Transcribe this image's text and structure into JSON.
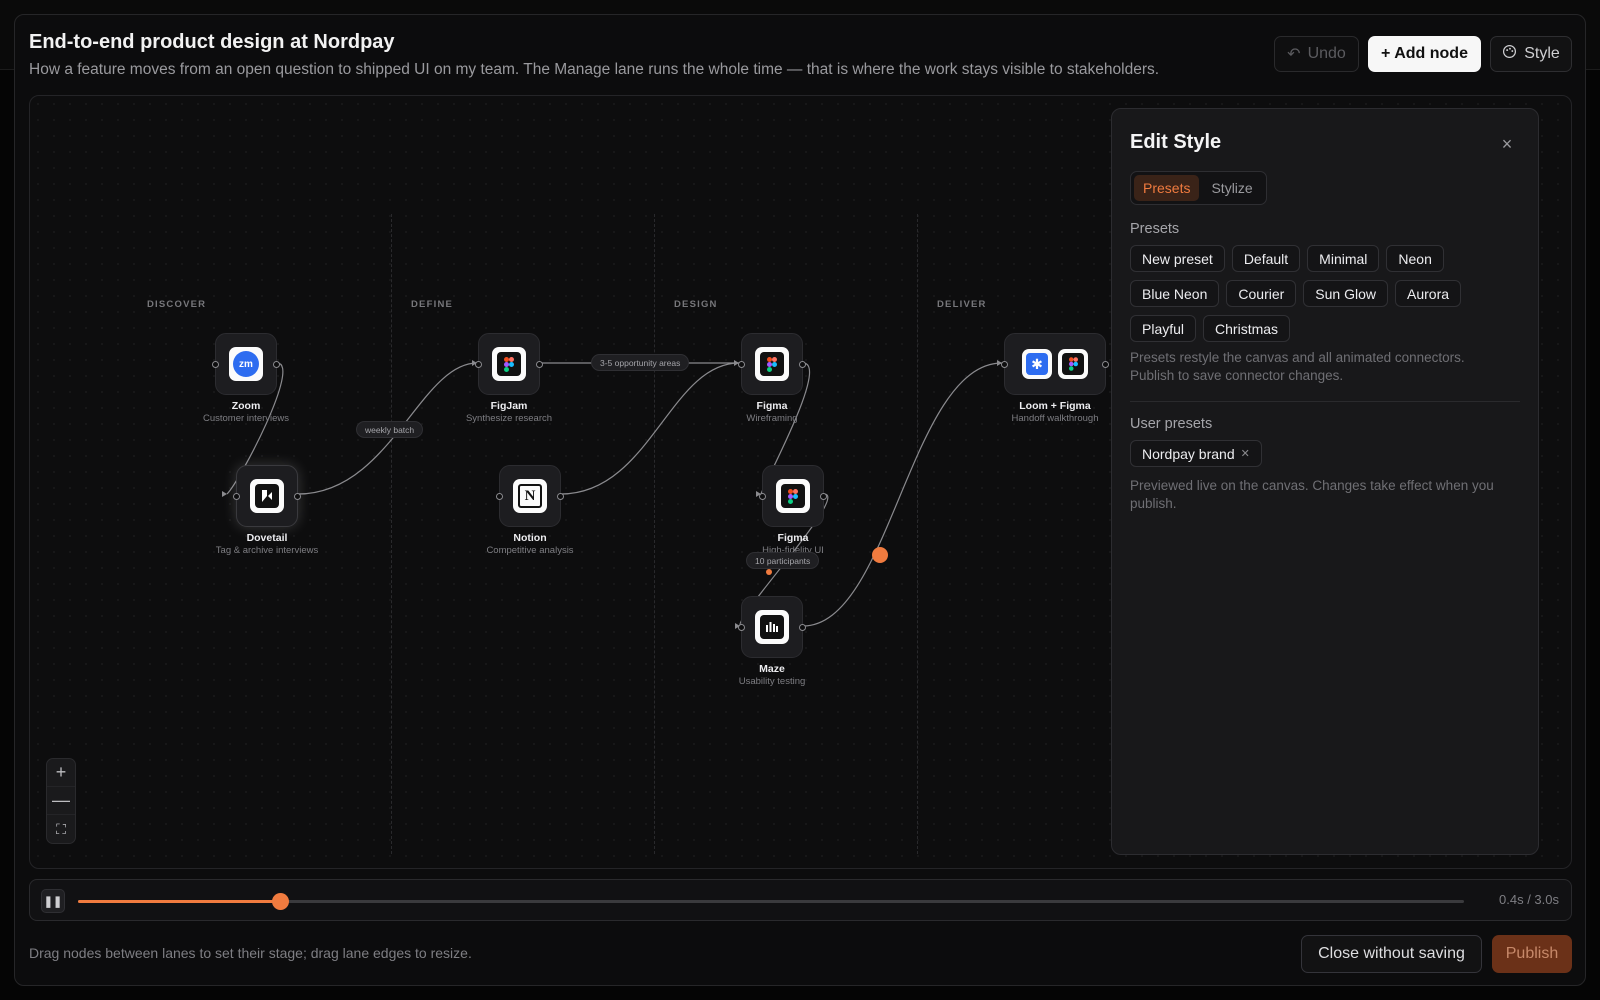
{
  "header": {
    "title": "End-to-end product design at Nordpay",
    "subtitle": "How a feature moves from an open question to shipped UI on my team. The Manage lane runs the whole time — that is where the work stays visible to stakeholders.",
    "undo_label": "Undo",
    "add_node_label": "+ Add node",
    "style_label": "Style"
  },
  "canvas": {
    "lanes": [
      "DISCOVER",
      "DEFINE",
      "DESIGN",
      "DELIVER"
    ],
    "nodes": {
      "zoom": {
        "name": "Zoom",
        "desc": "Customer interviews",
        "icon": "zoom-icon"
      },
      "dovetail": {
        "name": "Dovetail",
        "desc": "Tag & archive interviews",
        "icon": "dovetail-icon"
      },
      "figjam": {
        "name": "FigJam",
        "desc": "Synthesize research",
        "icon": "figma-icon"
      },
      "notion": {
        "name": "Notion",
        "desc": "Competitive analysis",
        "icon": "notion-icon"
      },
      "figma_wire": {
        "name": "Figma",
        "desc": "Wireframing",
        "icon": "figma-icon"
      },
      "figma_hifi": {
        "name": "Figma",
        "desc": "High-fidelity UI",
        "icon": "figma-icon"
      },
      "maze": {
        "name": "Maze",
        "desc": "Usability testing",
        "icon": "maze-icon"
      },
      "loom_figma": {
        "name": "Loom + Figma",
        "desc": "Handoff walkthrough",
        "icon": "loom-icon"
      }
    },
    "edge_labels": {
      "weekly": "weekly batch",
      "opportunity": "3-5 opportunity areas",
      "participants": "10 participants"
    },
    "zoom_controls": {
      "zoom_in": "+",
      "zoom_out": "—",
      "fit": "⛶"
    }
  },
  "style_panel": {
    "title": "Edit Style",
    "close": "×",
    "tabs": [
      {
        "label": "Presets",
        "active": true
      },
      {
        "label": "Stylize",
        "active": false
      }
    ],
    "presets_label": "Presets",
    "presets": [
      "New preset",
      "Default",
      "Minimal",
      "Neon",
      "Blue Neon",
      "Courier",
      "Sun Glow",
      "Aurora",
      "Playful",
      "Christmas"
    ],
    "presets_note": "Presets restyle the canvas and all animated connectors. Publish to save connector changes.",
    "user_presets_label": "User presets",
    "user_presets": [
      "Nordpay brand"
    ],
    "user_presets_note": "Previewed live on the canvas. Changes take effect when you publish."
  },
  "timeline": {
    "pause_icon": "pause-icon",
    "progress": 0.146,
    "time_text": "0.4s / 3.0s"
  },
  "footer": {
    "hint": "Drag nodes between lanes to set their stage; drag lane edges to resize.",
    "close_label": "Close without saving",
    "publish_label": "Publish"
  },
  "colors": {
    "accent": "#f07b3f",
    "background": "#0c0c0d",
    "panel": "#18181a"
  }
}
